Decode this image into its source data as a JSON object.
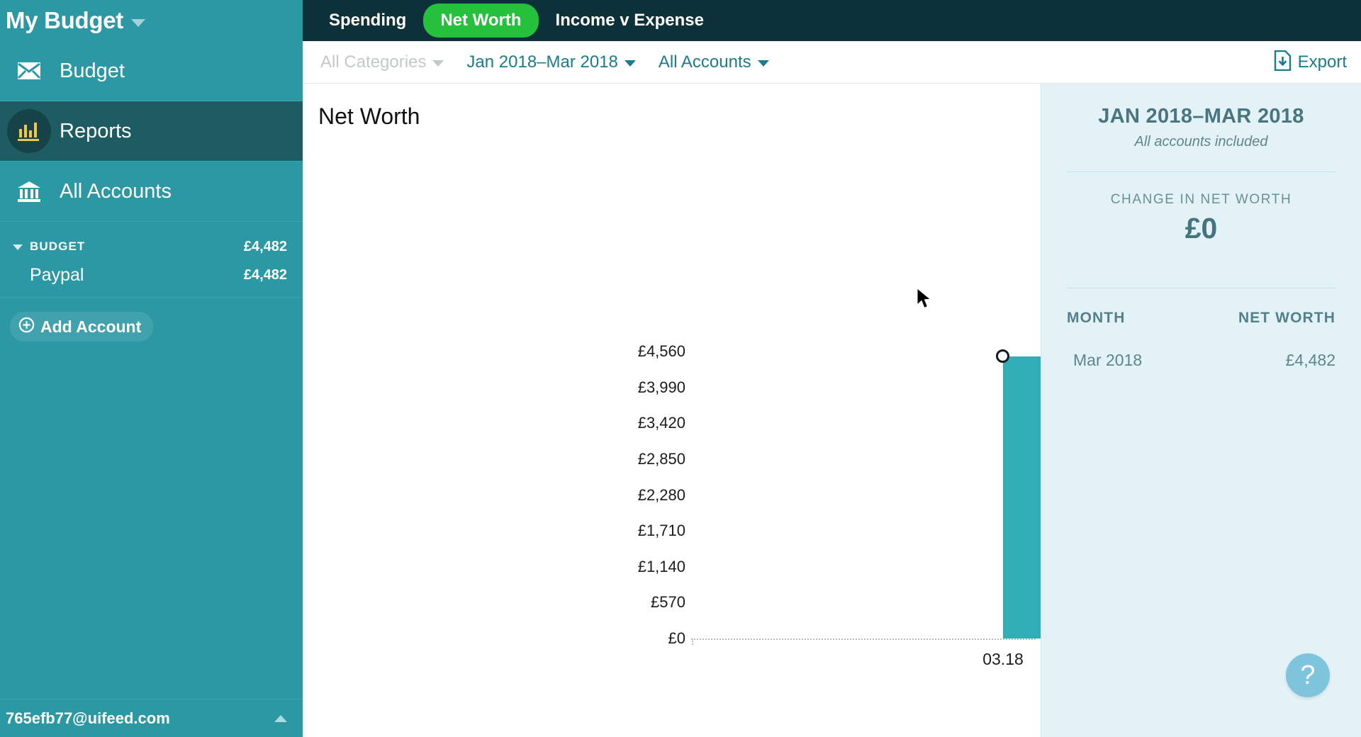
{
  "sidebar": {
    "brand": "My Budget",
    "nav": [
      {
        "label": "Budget",
        "icon": "envelope-icon"
      },
      {
        "label": "Reports",
        "icon": "bar-chart-icon"
      },
      {
        "label": "All Accounts",
        "icon": "bank-icon"
      }
    ],
    "accounts": {
      "group_label": "BUDGET",
      "group_amount": "£4,482",
      "items": [
        {
          "name": "Paypal",
          "amount": "£4,482"
        }
      ]
    },
    "add_account_label": "Add Account",
    "footer_email": "765efb77@uifeed.com"
  },
  "tabs": [
    {
      "label": "Spending",
      "active": false
    },
    {
      "label": "Net Worth",
      "active": true
    },
    {
      "label": "Income v Expense",
      "active": false
    }
  ],
  "filters": {
    "categories": "All Categories",
    "date_range": "Jan 2018–Mar 2018",
    "accounts": "All Accounts",
    "export_label": "Export"
  },
  "report": {
    "title": "Net Worth"
  },
  "side_panel": {
    "title": "JAN 2018–MAR 2018",
    "subtitle": "All accounts included",
    "metric_label": "CHANGE IN NET WORTH",
    "metric_value": "£0",
    "table": {
      "headers": [
        "MONTH",
        "NET WORTH"
      ],
      "rows": [
        [
          "Mar 2018",
          "£4,482"
        ]
      ]
    },
    "help_label": "?"
  },
  "chart_data": {
    "type": "bar",
    "title": "Net Worth",
    "categories": [
      "03.18"
    ],
    "values": [
      4482
    ],
    "xlabel": "",
    "ylabel": "",
    "ylim": [
      0,
      4560
    ],
    "ytick_labels": [
      "£4,560",
      "£3,990",
      "£3,420",
      "£2,850",
      "£2,280",
      "£1,710",
      "£1,140",
      "£570",
      "£0"
    ],
    "ytick_values": [
      4560,
      3990,
      3420,
      2850,
      2280,
      1710,
      1140,
      570,
      0
    ],
    "grid": false,
    "legend": "none",
    "bar_color": "#31adb5",
    "marker": {
      "category": "03.18",
      "value": 4482
    }
  },
  "colors": {
    "sidebar": "#2b98a4",
    "sidebar_active": "#1c5c62",
    "topbar": "#0c3138",
    "tab_active": "#25c13c",
    "accent_teal": "#1b7c8a",
    "bar": "#31adb5",
    "panel_bg": "#e2f2f7"
  }
}
